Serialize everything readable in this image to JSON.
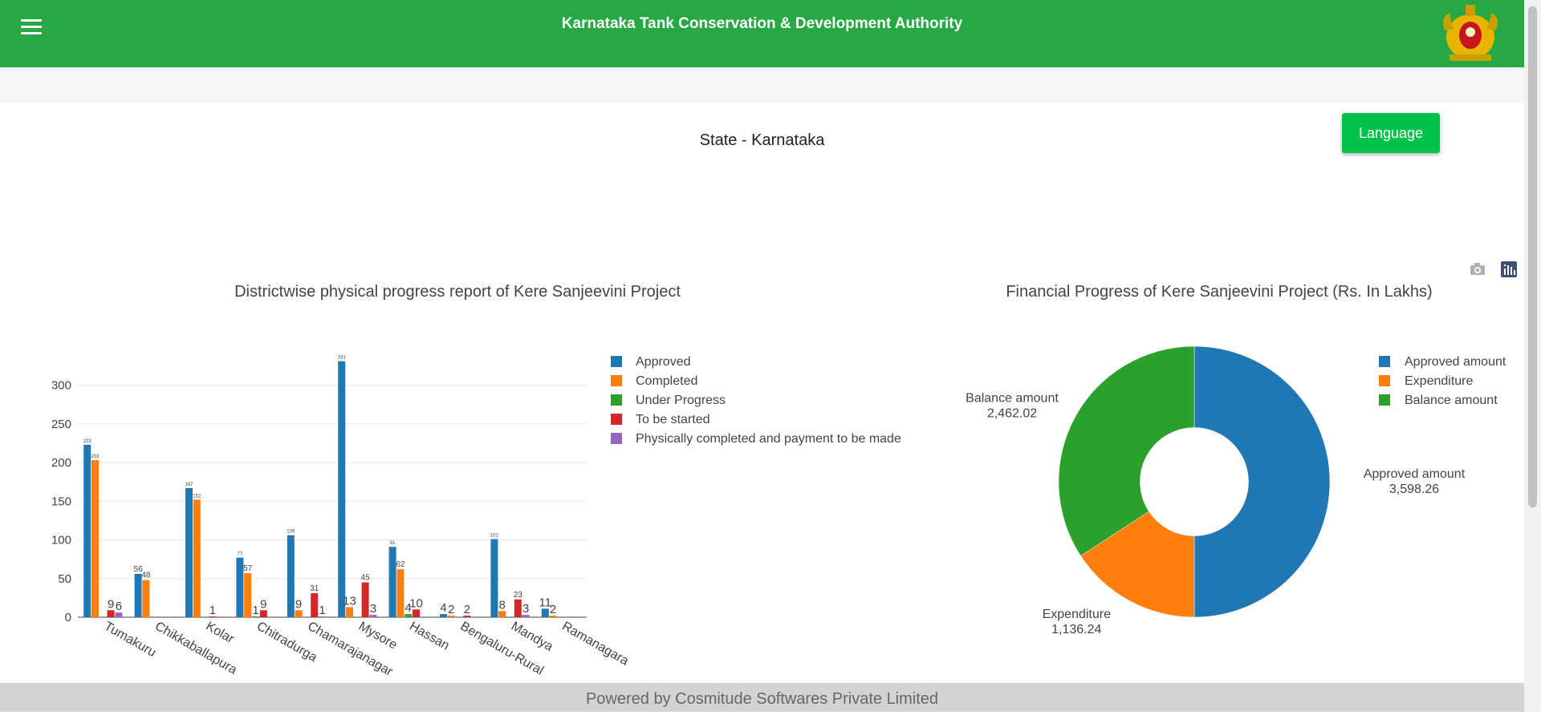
{
  "header": {
    "title": "Karnataka Tank Conservation & Development Authority",
    "menu_icon": "hamburger-menu-icon",
    "emblem_icon": "karnataka-emblem-icon"
  },
  "page": {
    "state_label": "State - Karnataka",
    "language_button": "Language"
  },
  "toolbar": {
    "camera_icon": "camera-icon",
    "plotly_icon": "plotly-logo-icon"
  },
  "footer": {
    "text": "Powered by Cosmitude Softwares Private Limited"
  },
  "colors": {
    "header_bg": "#28a745",
    "language_bg": "#00c24a",
    "approved": "#1f77b4",
    "completed": "#ff7f0e",
    "under_progress": "#2ca02c",
    "to_be_started": "#d62728",
    "payment_pending": "#9467bd"
  },
  "chart_data": [
    {
      "type": "bar",
      "title": "Districtwise  physical progress report of Kere Sanjeevini Project",
      "xlabel": "",
      "ylabel": "",
      "ylim": [
        0,
        345
      ],
      "yticks": [
        0,
        50,
        100,
        150,
        200,
        250,
        300
      ],
      "grid": true,
      "legend_position": "right",
      "categories": [
        "Tumakuru",
        "Chikkaballapura",
        "Kolar",
        "Chitradurga",
        "Chamarajanagar",
        "Mysore",
        "Hassan",
        "Bengaluru-Rural",
        "Mandya",
        "Ramanagara"
      ],
      "series": [
        {
          "name": "Approved",
          "color": "#1f77b4",
          "values": [
            223,
            56,
            167,
            77,
            106,
            331,
            91,
            4,
            101,
            11
          ]
        },
        {
          "name": "Completed",
          "color": "#ff7f0e",
          "values": [
            203,
            48,
            152,
            57,
            9,
            13,
            62,
            2,
            8,
            2
          ]
        },
        {
          "name": "Under Progress",
          "color": "#2ca02c",
          "values": [
            0,
            0,
            0,
            1,
            0,
            0,
            4,
            0,
            0,
            0
          ]
        },
        {
          "name": "To be started",
          "color": "#d62728",
          "values": [
            9,
            0,
            1,
            9,
            31,
            45,
            10,
            2,
            23,
            0
          ]
        },
        {
          "name": "Physically completed and payment to be made",
          "color": "#9467bd",
          "values": [
            6,
            0,
            0,
            0,
            1,
            3,
            0,
            0,
            3,
            0
          ]
        }
      ]
    },
    {
      "type": "pie",
      "hole": 0.4,
      "title": "Financial Progress of Kere Sanjeevini Project (Rs. In Lakhs)",
      "legend_position": "right",
      "labels": [
        "Approved amount",
        "Expenditure",
        "Balance amount"
      ],
      "values": [
        3598.26,
        1136.24,
        2462.02
      ],
      "value_labels": [
        "3,598.26",
        "1,136.24",
        "2,462.02"
      ],
      "colors": [
        "#1f77b4",
        "#ff7f0e",
        "#2ca02c"
      ]
    }
  ]
}
